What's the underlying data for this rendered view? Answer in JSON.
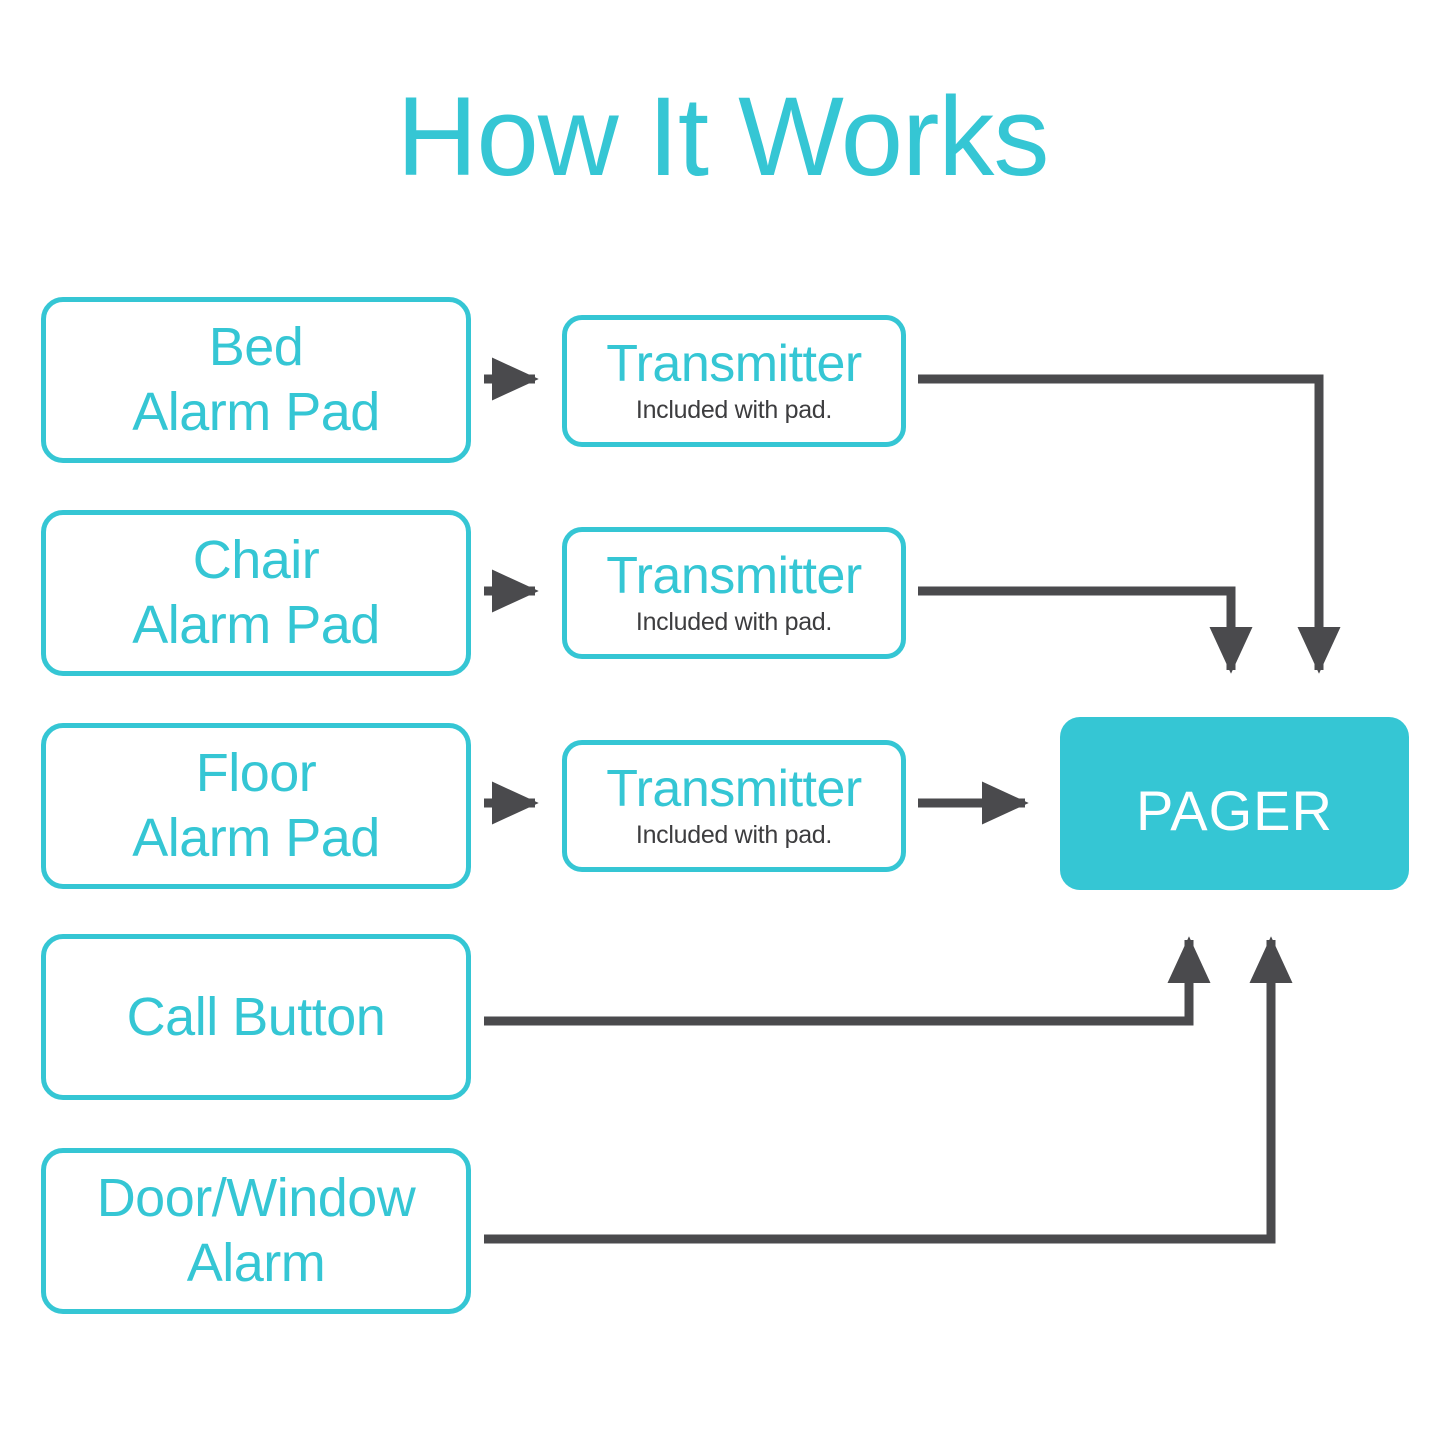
{
  "page": {
    "title": "How It Works",
    "background": "#ffffff",
    "accent_color": "#35C6D4",
    "line_color": "#4a4a4d",
    "subtext_color": "#3d3d3f",
    "pager_text_color": "#ffffff"
  },
  "sources": [
    {
      "id": "bed",
      "lines": [
        "Bed",
        "Alarm Pad"
      ]
    },
    {
      "id": "chair",
      "lines": [
        "Chair",
        "Alarm Pad"
      ]
    },
    {
      "id": "floor",
      "lines": [
        "Floor",
        "Alarm Pad"
      ]
    },
    {
      "id": "call",
      "lines": [
        "Call Button"
      ]
    },
    {
      "id": "doorwindow",
      "lines": [
        "Door/Window",
        "Alarm"
      ]
    }
  ],
  "transmitters": [
    {
      "id": "tx-bed",
      "title": "Transmitter",
      "subtitle": "Included with pad."
    },
    {
      "id": "tx-chair",
      "title": "Transmitter",
      "subtitle": "Included with pad."
    },
    {
      "id": "tx-floor",
      "title": "Transmitter",
      "subtitle": "Included with pad."
    }
  ],
  "pager": {
    "label": "PAGER"
  },
  "flows": [
    {
      "from": "bed",
      "to": "tx-bed",
      "type": "straight-right"
    },
    {
      "from": "chair",
      "to": "tx-chair",
      "type": "straight-right"
    },
    {
      "from": "floor",
      "to": "tx-floor",
      "type": "straight-right"
    },
    {
      "from": "tx-bed",
      "to": "pager",
      "type": "right-then-down"
    },
    {
      "from": "tx-chair",
      "to": "pager",
      "type": "right-then-down"
    },
    {
      "from": "tx-floor",
      "to": "pager",
      "type": "straight-right"
    },
    {
      "from": "call",
      "to": "pager",
      "type": "right-then-up"
    },
    {
      "from": "doorwindow",
      "to": "pager",
      "type": "right-then-up"
    }
  ]
}
